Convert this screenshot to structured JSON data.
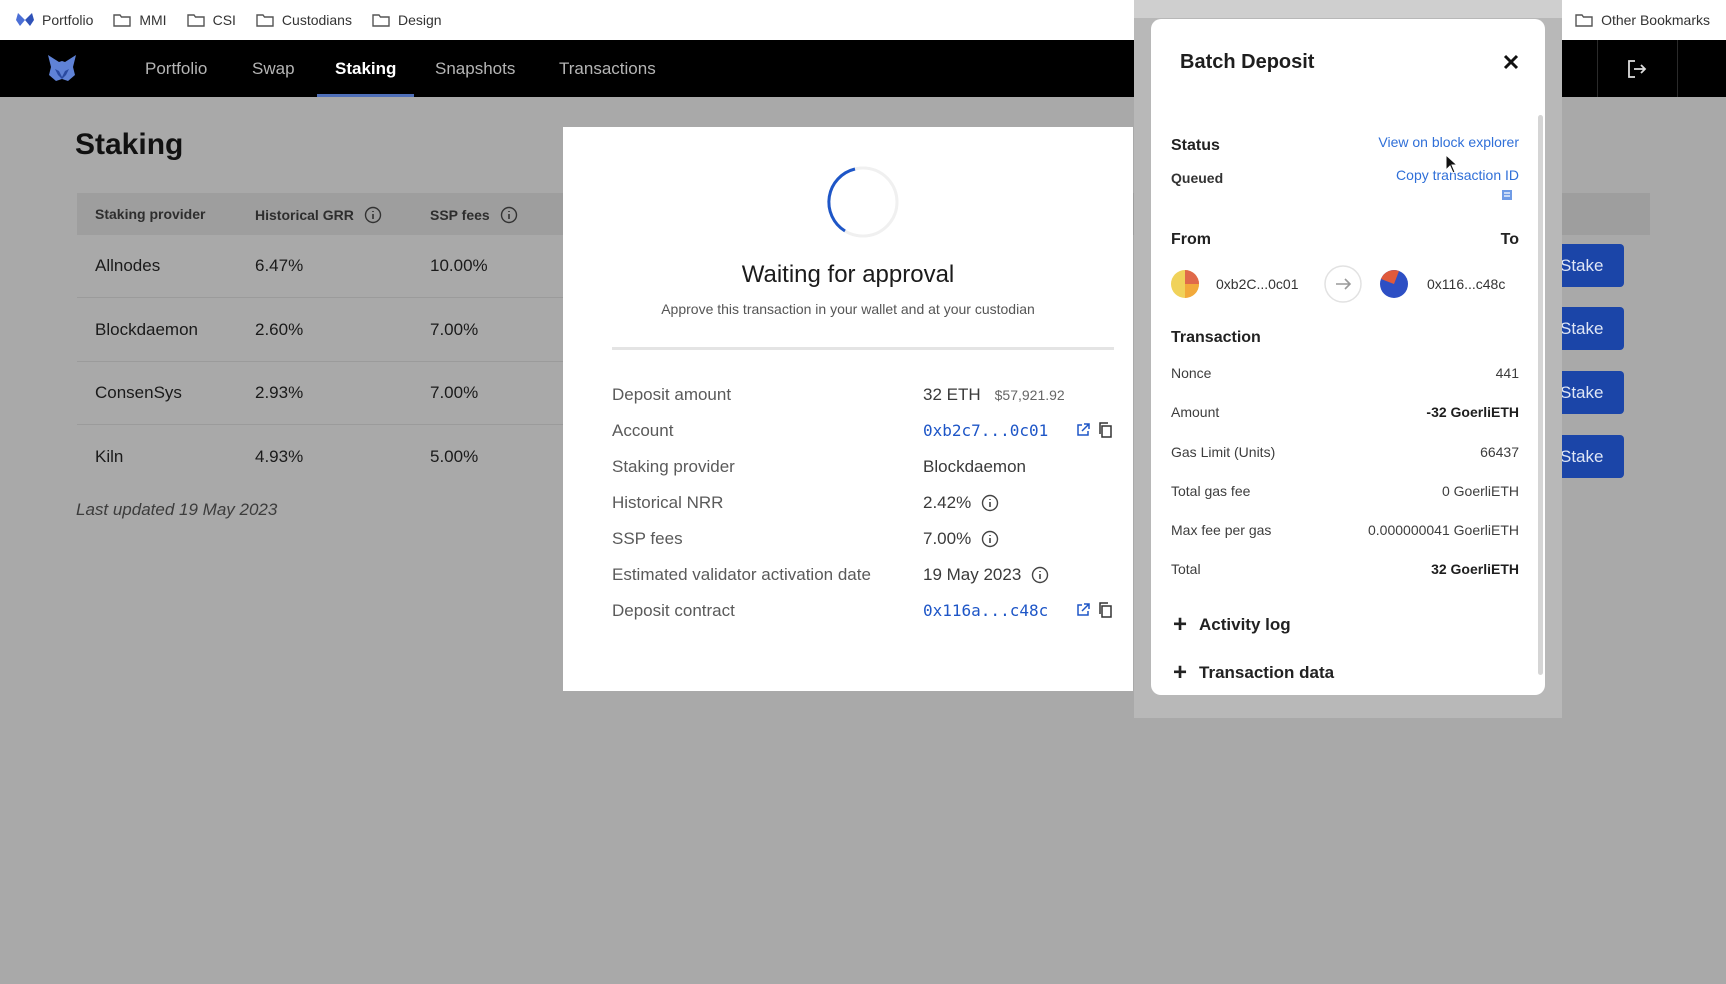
{
  "bookmarks": {
    "items": [
      {
        "label": "Portfolio",
        "icon": "butterfly-icon"
      },
      {
        "label": "MMI",
        "icon": "folder-icon"
      },
      {
        "label": "CSI",
        "icon": "folder-icon"
      },
      {
        "label": "Custodians",
        "icon": "folder-icon"
      },
      {
        "label": "Design",
        "icon": "folder-icon"
      }
    ],
    "other": "Other Bookmarks"
  },
  "nav": {
    "tabs": [
      "Portfolio",
      "Swap",
      "Staking",
      "Snapshots",
      "Transactions"
    ],
    "active": "Staking"
  },
  "staking": {
    "title": "Staking",
    "headers": [
      "Staking provider",
      "Historical GRR",
      "SSP fees"
    ],
    "rows": [
      {
        "provider": "Allnodes",
        "grr": "6.47%",
        "fees": "10.00%"
      },
      {
        "provider": "Blockdaemon",
        "grr": "2.60%",
        "fees": "7.00%"
      },
      {
        "provider": "ConsenSys",
        "grr": "2.93%",
        "fees": "7.00%"
      },
      {
        "provider": "Kiln",
        "grr": "4.93%",
        "fees": "5.00%"
      }
    ],
    "stake_label": "Stake",
    "last_updated": "Last updated 19 May 2023"
  },
  "waiting": {
    "title": "Waiting for approval",
    "subtitle": "Approve this transaction in your wallet and at your custodian",
    "details": [
      {
        "label": "Deposit amount",
        "value": "32 ETH",
        "extra": "$57,921.92"
      },
      {
        "label": "Account",
        "value": "0xb2c7...0c01"
      },
      {
        "label": "Staking provider",
        "value": "Blockdaemon"
      },
      {
        "label": "Historical NRR",
        "value": "2.42%"
      },
      {
        "label": "SSP fees",
        "value": "7.00%"
      },
      {
        "label": "Estimated validator activation date",
        "value": "19 May 2023"
      },
      {
        "label": "Deposit contract",
        "value": "0x116a...c48c"
      }
    ]
  },
  "batch": {
    "title": "Batch Deposit",
    "status_label": "Status",
    "status_value": "Queued",
    "view_explorer": "View on block explorer",
    "copy_tx": "Copy transaction ID",
    "from_label": "From",
    "to_label": "To",
    "from_addr": "0xb2C...0c01",
    "to_addr": "0x116...c48c",
    "transaction_label": "Transaction",
    "rows": [
      {
        "label": "Nonce",
        "value": "441"
      },
      {
        "label": "Amount",
        "value": "-32 GoerliETH"
      },
      {
        "label": "Gas Limit (Units)",
        "value": "66437"
      },
      {
        "label": "Total gas fee",
        "value": "0 GoerliETH"
      },
      {
        "label": "Max fee per gas",
        "value": "0.000000041 GoerliETH"
      },
      {
        "label": "Total",
        "value": "32 GoerliETH"
      }
    ],
    "activity_log": "Activity log",
    "transaction_data": "Transaction data"
  },
  "colors": {
    "accent_blue": "#1b45a8",
    "link_blue": "#2f6fd8",
    "nav_bg": "#000000",
    "overlay_bg": "#a9a9a9"
  }
}
